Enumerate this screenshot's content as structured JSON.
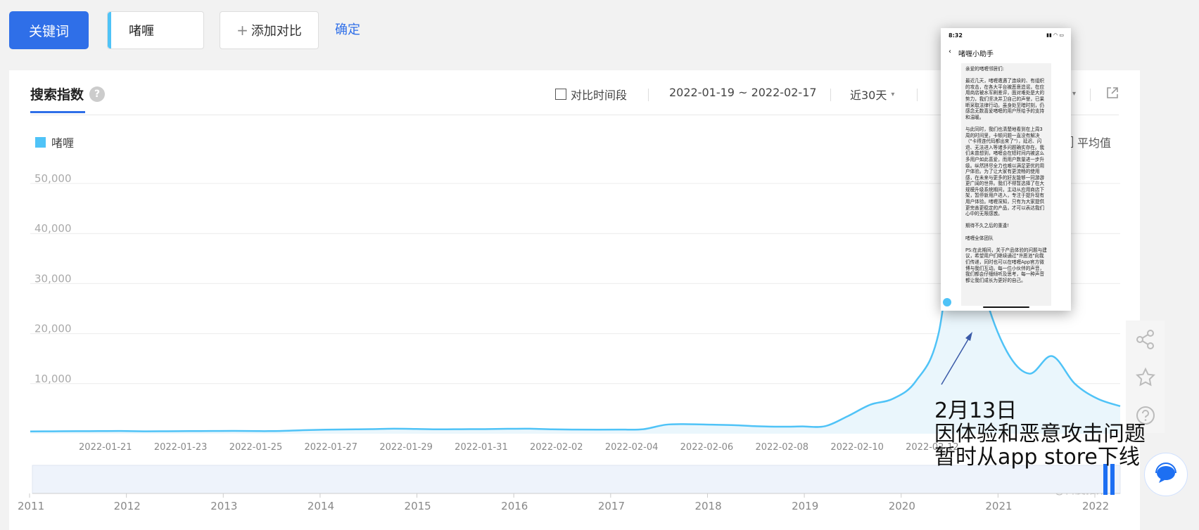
{
  "toolbar": {
    "keyword_button": "关键词",
    "keyword_value": "啫喱",
    "add_compare": "添加对比",
    "add_compare_icon": "plus-icon",
    "confirm": "确定"
  },
  "panel": {
    "tab_title": "搜索指数",
    "help_icon": "?",
    "compare_period": "对比时间段",
    "date_range": "2022-01-19 ~ 2022-02-17",
    "period_select": "近30天",
    "legend": "啫喱",
    "average": "平均值",
    "watermark": "@百度指数"
  },
  "colors": {
    "accent": "#2f6fe8",
    "series": "#4fc3f7",
    "annotation_arrow": "#3a5aa8"
  },
  "phone": {
    "status_time": "8:32",
    "nav_title": "啫喱小助手",
    "body": "亲爱的啫喱邻居们:\n\n最近几天，啫喱遭遇了连续的、有组织的攻击，在各大平台被恶意造谣，在应用商店被水军刷差评，面对难处是大的势力，我们坚决并卫自己的声誉，已果断采取法律行动。虽身处至暗时刻，仍感念无数喜爱啫喱的用户所给予的支持和温暖。\n\n与此同时，我们也清楚地看到在上周3周的时间里，卡顿问题一直没有解决（\"卡得连代码都出来了\"），延迟、闪退、无法进入等诸多问题确实存在。我们未曾想到，啫喱会在短时间内被这么多用户如此喜爱，而用户数量进一步升级。纵然拼尽全力也难以满足更优的用户体验。为了让大家有更流畅的使用感，在未来与更多的好友能够一同游游更广阔的世界。我们不得暂选择了在大规模升级系统期间，主动从应用商店下架，暂停新用户进入，专注于提升现有用户体验。啫喱深知，只有为大家提供更完善更稳定的产品，才可以表达我们心中的无限感激。\n\n期待不久之后的重逢!\n\n啫喱全体团队\n\nPS:在此期间，关于产品体验的问题与建议，希望用户们继续通过\"许愿池\"向我们传递，同时也可以在啫喱App官方微博与我们互动。每一位小伙伴的声音，我们都会仔细倾听及思考，每一种声音都让我们成长为更好的自己。"
  },
  "annotation": {
    "lines": [
      "2月13日",
      "因体验和恶意攻击问题",
      "暂时从app store下线"
    ]
  },
  "chart_data": {
    "type": "area",
    "series": [
      {
        "name": "啫喱",
        "values": [
          450,
          480,
          510,
          520,
          540,
          480,
          500,
          520,
          540,
          560,
          520,
          540,
          700,
          800,
          860,
          920,
          1000,
          950,
          880,
          900,
          920,
          980,
          1000,
          870,
          820,
          800,
          820,
          900,
          1800,
          1900,
          1800,
          1700,
          1500,
          1400,
          1450,
          1500,
          3500,
          5800,
          7000,
          10500,
          20000,
          49500,
          28500,
          16500,
          12000,
          15500,
          10000,
          7000,
          5500
        ]
      }
    ],
    "x_start": "2022-01-19",
    "x_end": "2022-02-17",
    "x_ticks": [
      "2022-01-21",
      "2022-01-23",
      "2022-01-25",
      "2022-01-27",
      "2022-01-29",
      "2022-01-31",
      "2022-02-02",
      "2022-02-04",
      "2022-02-06",
      "2022-02-08",
      "2022-02-10",
      "2022-02-12"
    ],
    "y_ticks": [
      "10,000",
      "20,000",
      "30,000",
      "40,000",
      "50,000"
    ],
    "ylim": [
      0,
      50000
    ],
    "grid": true,
    "timeline_years": [
      "2011",
      "2012",
      "2013",
      "2014",
      "2015",
      "2016",
      "2017",
      "2018",
      "2019",
      "2020",
      "2021",
      "2022"
    ]
  }
}
